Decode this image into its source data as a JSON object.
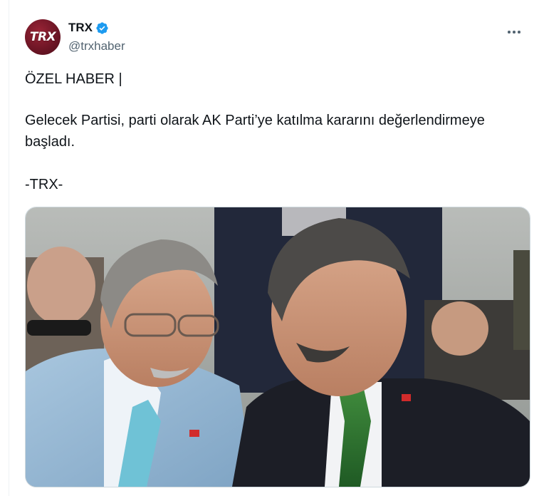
{
  "user": {
    "display_name": "TRX",
    "handle": "@trxhaber",
    "avatar_text": "TRX",
    "verified": true
  },
  "tweet": {
    "line1": "ÖZEL HABER |",
    "line2": "Gelecek Partisi, parti olarak AK Parti’ye katılma kararını değerlendirmeye başladı.",
    "line3": "-TRX-"
  },
  "media": {
    "alt": "photo"
  },
  "colors": {
    "verified": "#1d9bf0",
    "text": "#0f1419",
    "secondary": "#536471",
    "border": "#cfd9de",
    "avatar": "#7a1a2b"
  },
  "icons": {
    "verified": "verified-badge-icon",
    "more": "more-horizontal-icon"
  }
}
